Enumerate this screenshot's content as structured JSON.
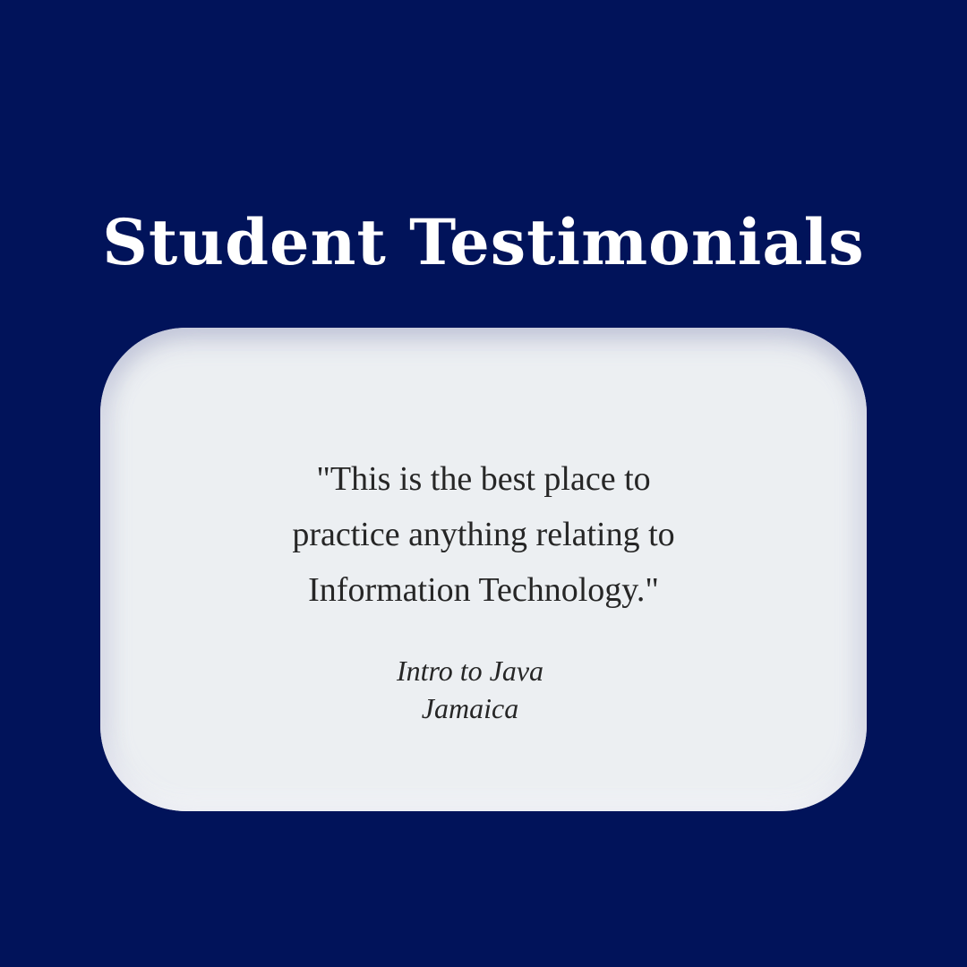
{
  "page": {
    "title": "Student Testimonials",
    "background_color": "#01135a",
    "title_color": "#ffffff"
  },
  "testimonial": {
    "quote_lines": [
      "\"This is the best place to",
      "practice anything relating to",
      "Information Technology.\""
    ],
    "course": "Intro to Java",
    "location": "Jamaica",
    "card_color": "#eceff2",
    "text_color": "#262626"
  }
}
